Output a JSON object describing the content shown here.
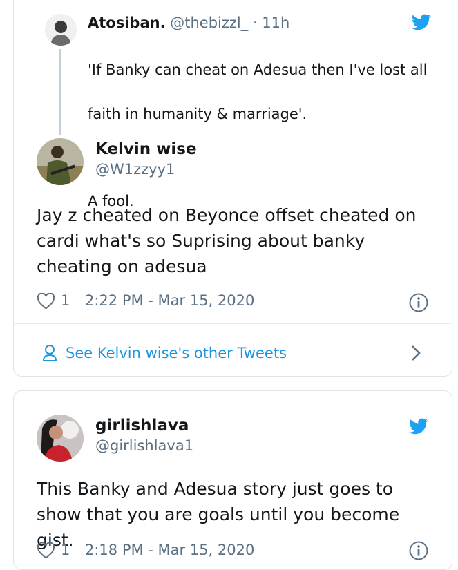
{
  "quoted_tweet": {
    "name": "Atosiban.",
    "handle": "@thebizzl_",
    "time": "· 11h",
    "text_line1": "'If Banky can cheat on Adesua then I've lost all",
    "text_line2": "faith in humanity & marriage'.",
    "text_line3": "A fool."
  },
  "tweet1": {
    "name": "Kelvin wise",
    "handle": "@W1zzyy1",
    "text": "Jay z cheated on Beyonce offset cheated on cardi what's so Suprising about banky cheating on adesua",
    "likes": "1",
    "timestamp": "2:22 PM - Mar 15, 2020",
    "other_tweets_label": "See Kelvin wise's other Tweets"
  },
  "tweet2": {
    "name": "girlishlava",
    "handle": "@girlishlava1",
    "text": "This Banky and Adesua story just goes to show that you are goals until you become gist.",
    "likes": "1",
    "timestamp": "2:18 PM - Mar 15, 2020"
  },
  "colors": {
    "twitter_blue": "#1da1f2",
    "link_blue": "#1b95e0",
    "muted": "#5b7083",
    "border": "#dde3e8"
  }
}
